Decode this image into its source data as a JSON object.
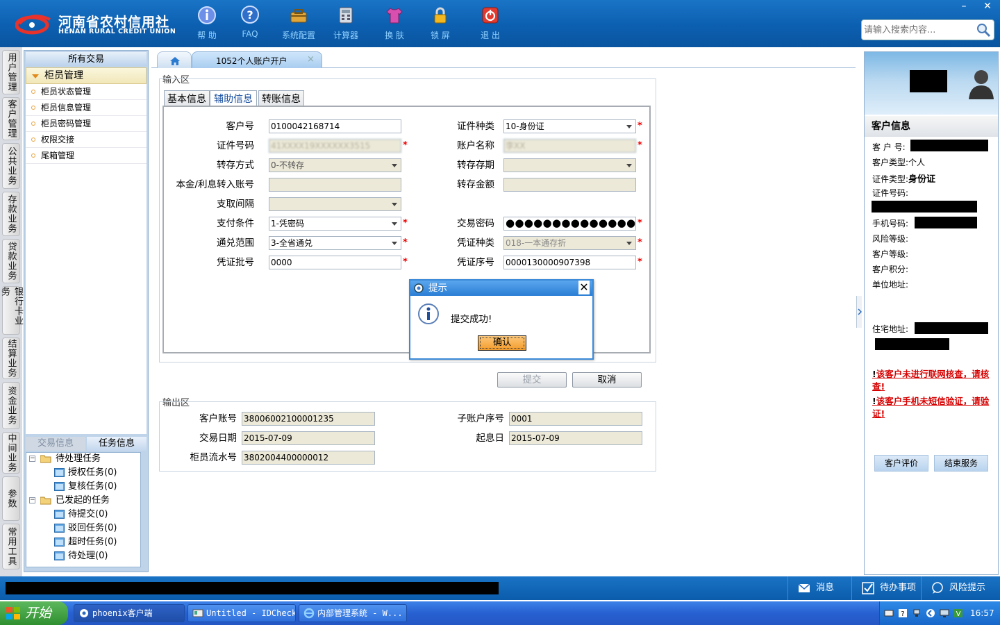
{
  "header": {
    "logo_cn": "河南省农村信用社",
    "logo_en": "HENAN RURAL CREDIT UNION",
    "toolbar": [
      {
        "icon": "info-icon",
        "label": "帮 助"
      },
      {
        "icon": "faq-icon",
        "label": "FAQ"
      },
      {
        "icon": "toolbox-icon",
        "label": "系统配置"
      },
      {
        "icon": "calculator-icon",
        "label": "计算器"
      },
      {
        "icon": "shirt-icon",
        "label": "换 肤"
      },
      {
        "icon": "lock-icon",
        "label": "锁 屏"
      },
      {
        "icon": "power-icon",
        "label": "退 出"
      }
    ],
    "search_placeholder": "请输入搜索内容...",
    "window_minimize": "–",
    "window_close": "✕"
  },
  "vertical_tabs": [
    "用户管理",
    "客户管理",
    "公共业务",
    "存款业务",
    "贷款业务",
    "银行卡业务",
    "结算业务",
    "资金业务",
    "中间业务",
    "参数",
    "常用工具"
  ],
  "left_nav": {
    "header": "所有交易",
    "group": "柜员管理",
    "items": [
      "柜员状态管理",
      "柜员信息管理",
      "柜员密码管理",
      "权限交接",
      "尾箱管理"
    ],
    "bottom_tabs": [
      "交易信息",
      "任务信息"
    ],
    "tree": {
      "pending": {
        "label": "待处理任务",
        "children": [
          "授权任务(0)",
          "复核任务(0)"
        ]
      },
      "initiated": {
        "label": "已发起的任务",
        "children": [
          "待提交(0)",
          "驳回任务(0)",
          "超时任务(0)",
          "待处理(0)"
        ]
      }
    }
  },
  "main": {
    "active_tab": "1052个人账户开户",
    "tab_close": "×",
    "input_section": "输入区",
    "subtabs": [
      "基本信息",
      "辅助信息",
      "转账信息"
    ],
    "form": {
      "customer_no": {
        "label": "客户号",
        "value": "0100042168714"
      },
      "id_type": {
        "label": "证件种类",
        "value": "10-身份证"
      },
      "id_no": {
        "label": "证件号码",
        "value": "41XXXX19XXXXXX3515"
      },
      "account_name": {
        "label": "账户名称",
        "value": "李XX"
      },
      "deposit_method": {
        "label": "转存方式",
        "value": "0-不转存"
      },
      "deposit_term": {
        "label": "转存存期",
        "value": ""
      },
      "transfer_account": {
        "label": "本金/利息转入账号",
        "value": ""
      },
      "transfer_amount": {
        "label": "转存金额",
        "value": ""
      },
      "withdraw_interval": {
        "label": "支取间隔",
        "value": ""
      },
      "pay_condition": {
        "label": "支付条件",
        "value": "1-凭密码"
      },
      "trade_password": {
        "label": "交易密码",
        "value": "●●●●●●●●●●●●●●●"
      },
      "exchange_scope": {
        "label": "通兑范围",
        "value": "3-全省通兑"
      },
      "voucher_type": {
        "label": "凭证种类",
        "value": "018-一本通存折"
      },
      "voucher_batch": {
        "label": "凭证批号",
        "value": "0000"
      },
      "voucher_seq": {
        "label": "凭证序号",
        "value": "0000130000907398"
      }
    },
    "required_mark": "*",
    "submit_label": "提交",
    "cancel_label": "取消",
    "output_section": "输出区",
    "output": {
      "customer_account": {
        "label": "客户账号",
        "value": "38006002100001235"
      },
      "sub_account_seq": {
        "label": "子账户序号",
        "value": "0001"
      },
      "trade_date": {
        "label": "交易日期",
        "value": "2015-07-09"
      },
      "start_date": {
        "label": "起息日",
        "value": "2015-07-09"
      },
      "teller_serial": {
        "label": "柜员流水号",
        "value": "3802004400000012"
      }
    }
  },
  "dialog": {
    "title": "提示",
    "message": "提交成功!",
    "ok_label": "确认",
    "close": "✕"
  },
  "customer_panel": {
    "title": "客户信息",
    "customer_no_label": "客 户 号:",
    "customer_type_label": "客户类型:",
    "customer_type_value": "个人",
    "id_type_label": "证件类型:",
    "id_type_value": "身份证",
    "id_no_label": "证件号码:",
    "phone_label": "手机号码:",
    "risk_label": "风险等级:",
    "level_label": "客户等级:",
    "points_label": "客户积分:",
    "company_addr_label": "单位地址:",
    "home_addr_label": "住宅地址:",
    "warn_bang": "!",
    "warning_1": "该客户未进行联网核查，请核查!",
    "warning_2": "该客户手机未短信验证，请验证!",
    "rate_button": "客户评价",
    "end_button": "结束服务"
  },
  "statusbar": {
    "messages": "消息",
    "todo": "待办事项",
    "risk": "风险提示"
  },
  "taskbar": {
    "start": "开始",
    "tasks": [
      "phoenix客户端",
      "Untitled - IDCheck",
      "内部管理系统 - W..."
    ],
    "clock": "16:57"
  }
}
